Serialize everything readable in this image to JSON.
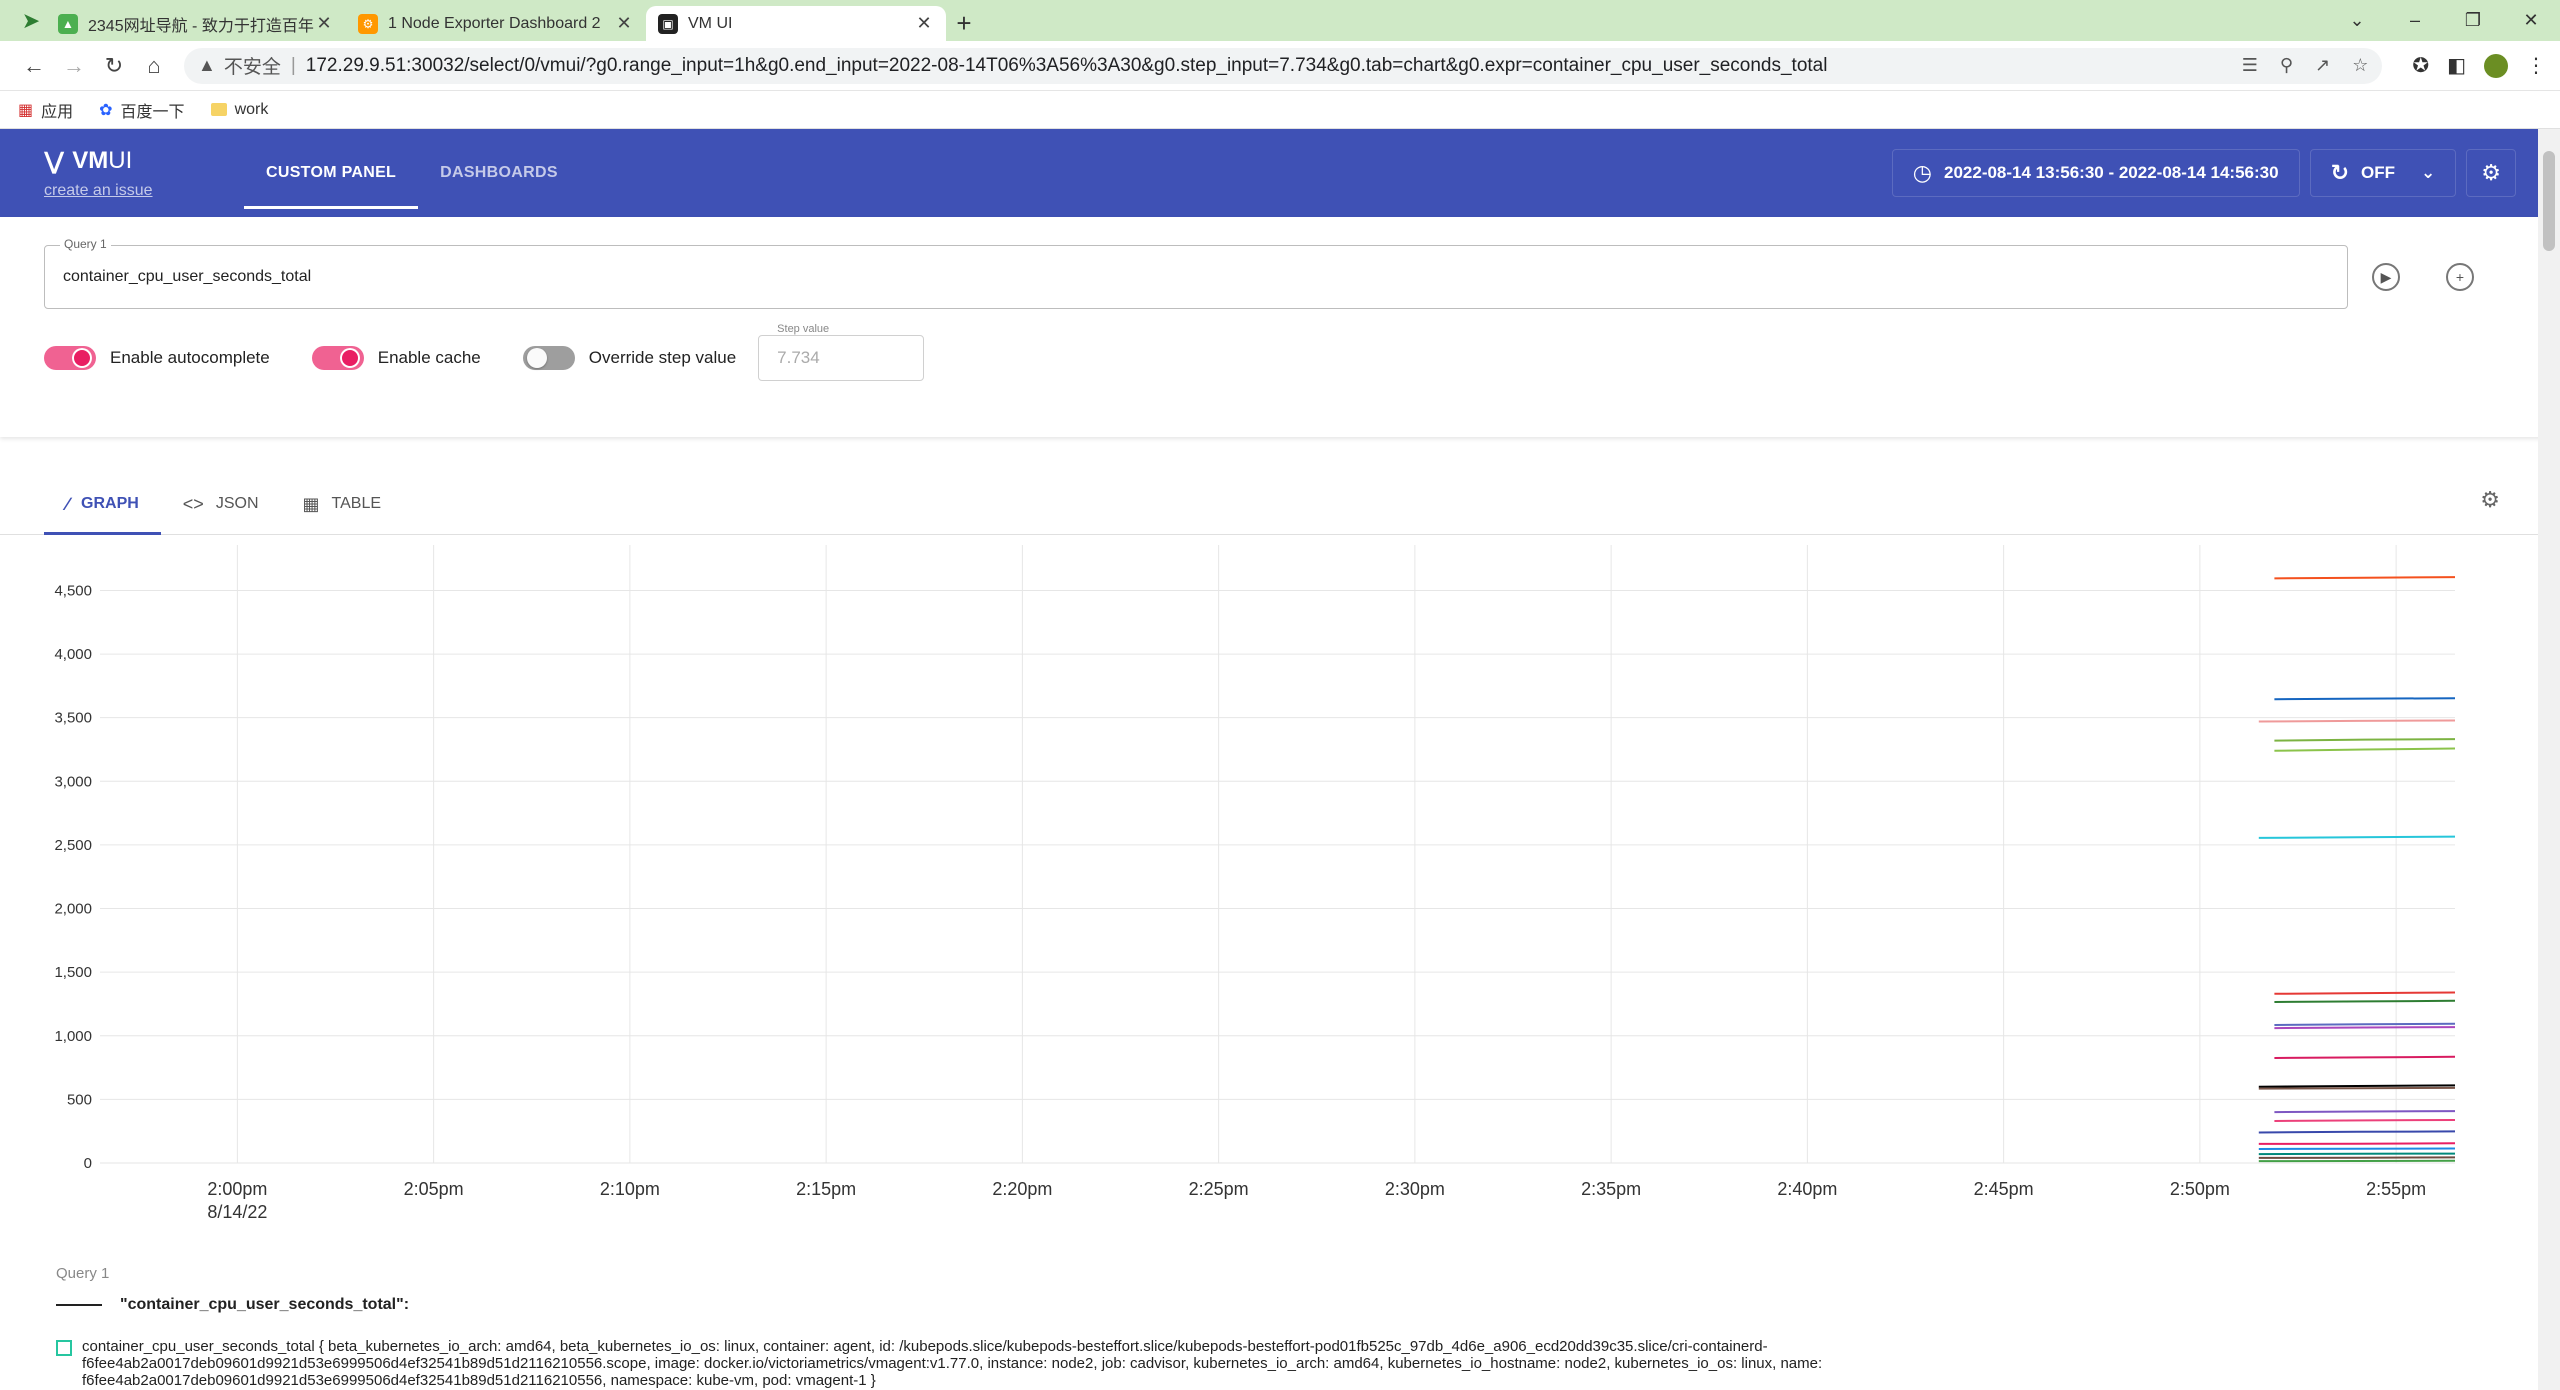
{
  "browser": {
    "tabs": [
      {
        "title": "2345网址导航 - 致力于打造百年品牌",
        "fav": "#4caf50"
      },
      {
        "title": "1 Node Exporter Dashboard 2",
        "fav": "#ff9800"
      },
      {
        "title": "VM UI",
        "fav": "#222"
      }
    ],
    "insecure_label": "不安全",
    "url": "172.29.9.51:30032/select/0/vmui/?g0.range_input=1h&g0.end_input=2022-08-14T06%3A56%3A30&g0.step_input=7.734&g0.tab=chart&g0.expr=container_cpu_user_seconds_total",
    "bookmarks": [
      {
        "label": "应用",
        "icon": "apps-icon"
      },
      {
        "label": "百度一下",
        "icon": "baidu-icon"
      },
      {
        "label": "work",
        "icon": "folder-icon"
      }
    ]
  },
  "header": {
    "logo_vm": "VM",
    "logo_ui": "UI",
    "issue_link": "create an issue",
    "tabs": [
      "CUSTOM PANEL",
      "DASHBOARDS"
    ],
    "time_range": "2022-08-14 13:56:30 - 2022-08-14 14:56:30",
    "refresh": "OFF"
  },
  "query": {
    "label": "Query 1",
    "expr": "container_cpu_user_seconds_total",
    "autocomplete_label": "Enable autocomplete",
    "cache_label": "Enable cache",
    "override_label": "Override step value",
    "step_label": "Step value",
    "step_value": "7.734"
  },
  "result_tabs": [
    "GRAPH",
    "JSON",
    "TABLE"
  ],
  "colors": {
    "accent": "#3f51b5",
    "toggle_on": "#e91e63"
  },
  "chart_data": {
    "type": "line",
    "y_ticks": [
      "0",
      "500",
      "1,000",
      "1,500",
      "2,000",
      "2,500",
      "3,000",
      "3,500",
      "4,000",
      "4,500"
    ],
    "y_values": [
      0,
      500,
      1000,
      1500,
      2000,
      2500,
      3000,
      3500,
      4000,
      4500
    ],
    "x_ticks": [
      "2:00pm",
      "2:05pm",
      "2:10pm",
      "2:15pm",
      "2:20pm",
      "2:25pm",
      "2:30pm",
      "2:35pm",
      "2:40pm",
      "2:45pm",
      "2:50pm",
      "2:55pm"
    ],
    "x_minutes": [
      0,
      5,
      10,
      15,
      20,
      25,
      30,
      35,
      40,
      45,
      50,
      55
    ],
    "x_date": "8/14/22",
    "x_range_minutes": [
      -3.5,
      56.5
    ],
    "ylim": [
      0,
      4700
    ],
    "grid": true,
    "series": [
      {
        "color": "#f4511e",
        "start": 51.9,
        "values": [
          4595,
          4600,
          4605
        ]
      },
      {
        "color": "#1565c0",
        "start": 51.9,
        "values": [
          3645,
          3650,
          3652
        ]
      },
      {
        "color": "#ef9a9a",
        "start": 51.5,
        "values": [
          3470,
          3475,
          3478
        ]
      },
      {
        "color": "#7cb342",
        "start": 51.9,
        "values": [
          3320,
          3328,
          3332
        ]
      },
      {
        "color": "#8bc34a",
        "start": 51.9,
        "values": [
          3240,
          3250,
          3258
        ]
      },
      {
        "color": "#26c6da",
        "start": 51.5,
        "values": [
          2555,
          2560,
          2565
        ]
      },
      {
        "color": "#e53935",
        "start": 51.9,
        "values": [
          1330,
          1335,
          1340
        ]
      },
      {
        "color": "#2e7d32",
        "start": 51.9,
        "values": [
          1265,
          1270,
          1275
        ]
      },
      {
        "color": "#5c6bc0",
        "start": 51.9,
        "values": [
          1085,
          1090,
          1095
        ]
      },
      {
        "color": "#ab47bc",
        "start": 51.9,
        "values": [
          1060,
          1065,
          1068
        ]
      },
      {
        "color": "#d81b60",
        "start": 51.9,
        "values": [
          825,
          830,
          835
        ]
      },
      {
        "color": "#000000",
        "start": 51.5,
        "values": [
          600,
          605,
          610
        ]
      },
      {
        "color": "#795548",
        "start": 51.5,
        "values": [
          585,
          588,
          590
        ]
      },
      {
        "color": "#7e57c2",
        "start": 51.9,
        "values": [
          400,
          405,
          408
        ]
      },
      {
        "color": "#ec407a",
        "start": 51.9,
        "values": [
          330,
          335,
          338
        ]
      },
      {
        "color": "#3949ab",
        "start": 51.5,
        "values": [
          240,
          245,
          248
        ]
      },
      {
        "color": "#e91e63",
        "start": 51.5,
        "values": [
          150,
          152,
          155
        ]
      },
      {
        "color": "#1e88e5",
        "start": 51.5,
        "values": [
          110,
          112,
          114
        ]
      },
      {
        "color": "#00897b",
        "start": 51.5,
        "values": [
          70,
          72,
          74
        ]
      },
      {
        "color": "#6d4c41",
        "start": 51.5,
        "values": [
          40,
          42,
          44
        ]
      },
      {
        "color": "#43a047",
        "start": 51.5,
        "values": [
          15,
          16,
          18
        ]
      }
    ]
  },
  "legend": {
    "query_label": "Query 1",
    "group_name": "\"container_cpu_user_seconds_total\":",
    "first_item": "container_cpu_user_seconds_total  { beta_kubernetes_io_arch: amd64,  beta_kubernetes_io_os: linux,  container: agent,  id: /kubepods.slice/kubepods-besteffort.slice/kubepods-besteffort-pod01fb525c_97db_4d6e_a906_ecd20dd39c35.slice/cri-containerd-f6fee4ab2a0017deb09601d9921d53e6999506d4ef32541b89d51d2116210556.scope,  image: docker.io/victoriametrics/vmagent:v1.77.0,  instance: node2,  job: cadvisor,  kubernetes_io_arch: amd64,  kubernetes_io_hostname: node2,  kubernetes_io_os: linux,  name: f6fee4ab2a0017deb09601d9921d53e6999506d4ef32541b89d51d2116210556,  namespace: kube-vm,  pod: vmagent-1 }"
  }
}
